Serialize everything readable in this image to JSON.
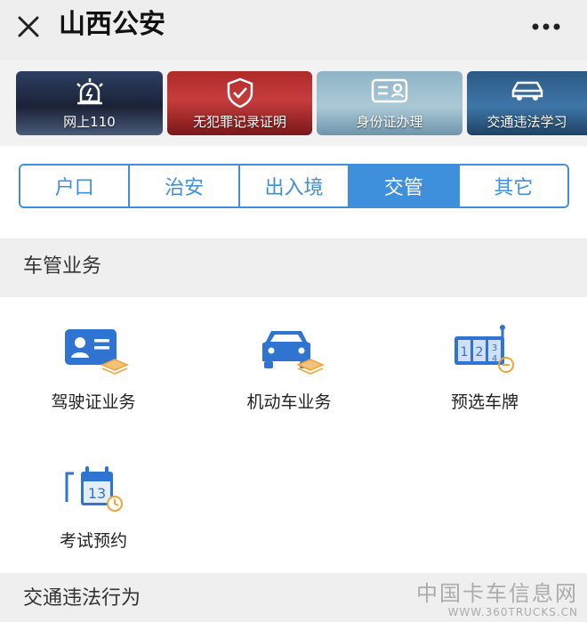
{
  "header": {
    "title": "山西公安"
  },
  "banners": [
    {
      "label": "网上110"
    },
    {
      "label": "无犯罪记录证明"
    },
    {
      "label": "身份证办理"
    },
    {
      "label": "交通违法学习"
    }
  ],
  "tabs": [
    {
      "label": "户口"
    },
    {
      "label": "治安"
    },
    {
      "label": "出入境"
    },
    {
      "label": "交管",
      "active": true
    },
    {
      "label": "其它"
    }
  ],
  "section1": {
    "title": "车管业务"
  },
  "services": [
    {
      "label": "驾驶证业务"
    },
    {
      "label": "机动车业务"
    },
    {
      "label": "预选车牌"
    },
    {
      "label": "考试预约"
    }
  ],
  "section2": {
    "title": "交通违法行为"
  },
  "watermark": {
    "line1": "中国卡车信息网",
    "line2": "WWW.360TRUCKS.CN"
  },
  "colors": {
    "accent": "#3e8fdc",
    "icon_blue": "#2f74d0",
    "icon_orange": "#f0a33a",
    "section_bg": "#efefef"
  }
}
